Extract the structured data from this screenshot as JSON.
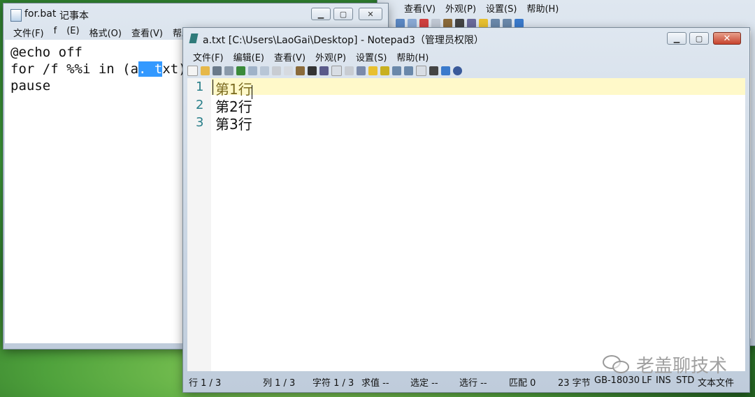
{
  "back_window": {
    "menu": [
      "查看(V)",
      "外观(P)",
      "设置(S)",
      "帮助(H)"
    ]
  },
  "notepad": {
    "title_file": "for.bat",
    "title_suffix": "记事本",
    "menu": [
      "文件(F)",
      "f",
      "(E)",
      "格式(O)",
      "查看(V)",
      "帮助("
    ],
    "code": {
      "line1": "@echo off",
      "line2_before": "for /f %%i in (a",
      "line2_sel": ". t",
      "line2_after": "xt)",
      "line3": "pause"
    }
  },
  "notepad3": {
    "title": "a.txt [C:\\Users\\LaoGai\\Desktop] - Notepad3（管理员权限）",
    "menu": [
      "文件(F)",
      "编辑(E)",
      "查看(V)",
      "外观(P)",
      "设置(S)",
      "帮助(H)"
    ],
    "lines": [
      {
        "num": "1",
        "text": "第1行"
      },
      {
        "num": "2",
        "text": "第2行"
      },
      {
        "num": "3",
        "text": "第3行"
      }
    ],
    "status": {
      "line": "行 1 / 3",
      "col": "列 1 / 3",
      "char": "字符 1 / 3",
      "sum": "求值 --",
      "sel": "选定 --",
      "selline": "选行 --",
      "match": "匹配 0",
      "bytes": "23 字节",
      "encoding": "GB-18030",
      "eol": "LF",
      "ins": "INS",
      "std": "STD",
      "type": "文本文件"
    }
  },
  "watermark": "老盖聊技术",
  "colors": {
    "accent": "#3399ff",
    "line_number": "#2a7f8a",
    "current_line": "#fff9c9",
    "close_button": "#c7432d"
  }
}
